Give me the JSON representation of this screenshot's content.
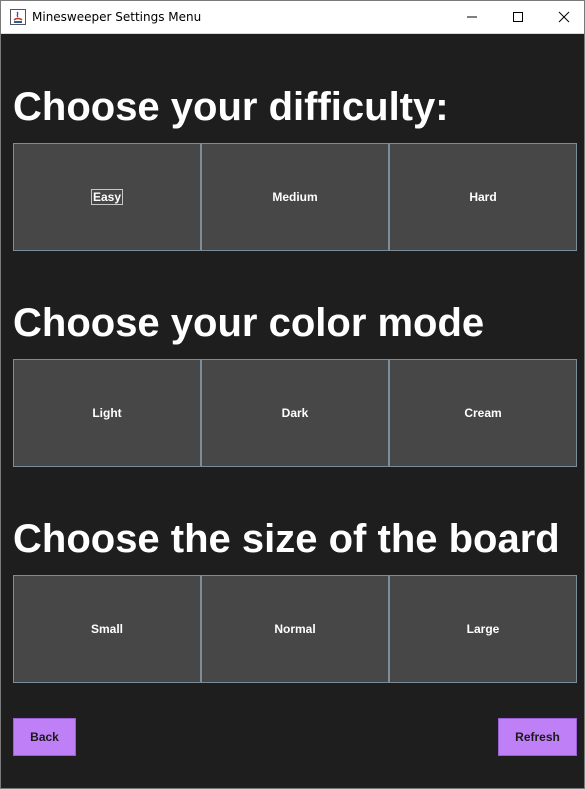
{
  "window": {
    "title": "Minesweeper Settings Menu",
    "app_icon": "java-app-icon",
    "controls": [
      "minimize-icon",
      "maximize-icon",
      "close-icon"
    ]
  },
  "difficulty": {
    "heading": "Choose your difficulty:",
    "options": [
      "Easy",
      "Medium",
      "Hard"
    ],
    "focused": "Easy"
  },
  "color_mode": {
    "heading": "Choose your color mode",
    "options": [
      "Light",
      "Dark",
      "Cream"
    ]
  },
  "board_size": {
    "heading": "Choose the size of the board",
    "options": [
      "Small",
      "Normal",
      "Large"
    ]
  },
  "actions": {
    "back_label": "Back",
    "refresh_label": "Refresh"
  },
  "colors": {
    "background": "#1e1e1e",
    "option_button": "#474747",
    "option_border": "#7d8c99",
    "action_button": "#bf80f7",
    "heading_text": "#ffffff"
  }
}
